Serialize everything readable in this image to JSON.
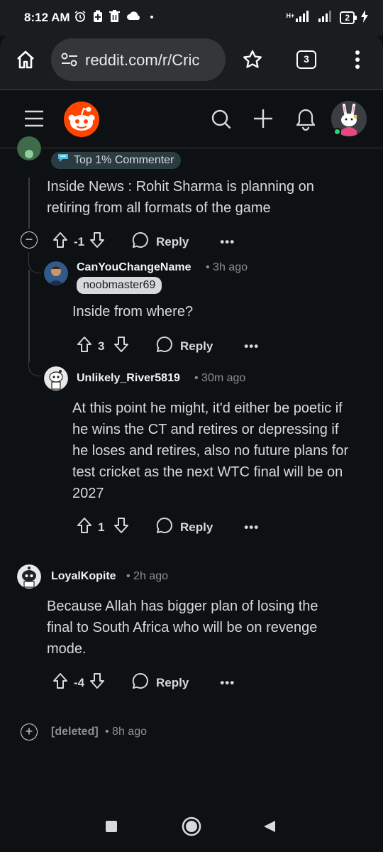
{
  "status_bar": {
    "time": "8:12 AM",
    "network": "H+",
    "battery": "2",
    "icons": [
      "alarm-icon",
      "battery-saver-icon",
      "trash-icon",
      "cloud-icon",
      "dot-icon",
      "signal-icon",
      "signal-icon",
      "charging-icon"
    ]
  },
  "browser": {
    "url": "reddit.com/r/Cric",
    "tab_count": "3"
  },
  "comments": {
    "c1": {
      "flair": "Top 1% Commenter",
      "body": [
        "Inside News : Rohit Sharma is planning on",
        "retiring from all formats of the game"
      ],
      "score": "-1",
      "reply_label": "Reply"
    },
    "c2": {
      "username": "CanYouChangeName",
      "time": "• 3h ago",
      "user_flair": "noobmaster69",
      "body": [
        "Inside from where?"
      ],
      "score": "3",
      "reply_label": "Reply"
    },
    "c3": {
      "username": "Unlikely_River5819",
      "time": "• 30m ago",
      "body": [
        "At this point he might, it'd either be poetic if",
        "he wins the CT and retires or depressing if",
        "he loses and retires, also no future plans for",
        "test cricket as the next WTC final will be on",
        "2027"
      ],
      "score": "1",
      "reply_label": "Reply"
    },
    "c4": {
      "username": "LoyalKopite",
      "time": "• 2h ago",
      "body": [
        "Because Allah has bigger plan of losing the",
        "final to South Africa who will be on revenge",
        "mode."
      ],
      "score": "-4",
      "reply_label": "Reply"
    },
    "c5": {
      "username": "[deleted]",
      "time": "• 8h ago"
    }
  },
  "colors": {
    "background": "#0e1113",
    "reddit_orange": "#ff4500",
    "text": "#d7dadc",
    "muted": "#8b8f93"
  }
}
